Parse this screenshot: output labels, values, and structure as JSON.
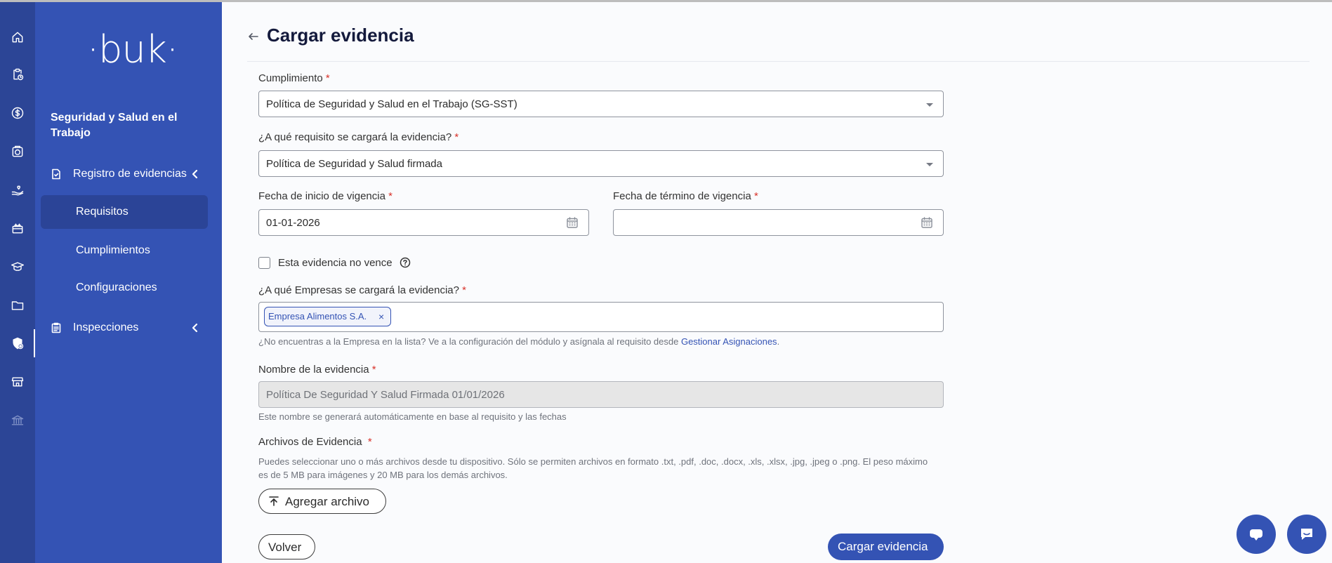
{
  "sidebar": {
    "logo": "·buk·",
    "module_title": "Seguridad y Salud en el Trabajo",
    "nav": {
      "registro": "Registro de evidencias",
      "requisitos": "Requisitos",
      "cumplimientos": "Cumplimientos",
      "configuraciones": "Configuraciones",
      "inspecciones": "Inspecciones"
    }
  },
  "rail_icons": [
    "home-icon",
    "clipboard-clock-icon",
    "dollar-circle-icon",
    "camera-icon",
    "hand-heart-icon",
    "gift-icon",
    "graduation-cap-icon",
    "folder-icon",
    "shield-gear-icon",
    "store-icon",
    "bank-icon"
  ],
  "page": {
    "title": "Cargar evidencia"
  },
  "form": {
    "required_mark": "*",
    "cumplimiento": {
      "label": "Cumplimiento",
      "value": "Política de Seguridad y Salud en el Trabajo (SG-SST)"
    },
    "requisito": {
      "label": "¿A qué requisito se cargará la evidencia?",
      "value": "Política de Seguridad y Salud firmada"
    },
    "fecha_inicio": {
      "label": "Fecha de inicio de vigencia",
      "value": "01-01-2026"
    },
    "fecha_termino": {
      "label": "Fecha de término de vigencia",
      "value": ""
    },
    "no_vence": {
      "label": "Esta evidencia no vence",
      "checked": false
    },
    "empresas": {
      "label": "¿A qué Empresas se cargará la evidencia?",
      "chips": [
        "Empresa Alimentos S.A."
      ],
      "chip_remove": "×",
      "hint": "¿No encuentras a la Empresa en la lista? Ve a la configuración del módulo y asígnala al requisito desde ",
      "hint_link": "Gestionar Asignaciones",
      "hint_end": "."
    },
    "nombre": {
      "label": "Nombre de la evidencia",
      "value": "Política De Seguridad Y Salud Firmada 01/01/2026",
      "hint": "Este nombre se generará automáticamente en base al requisito y las fechas"
    },
    "archivos": {
      "label": "Archivos de Evidencia",
      "description": "Puedes seleccionar uno o más archivos desde tu dispositivo. Sólo se permiten archivos en formato .txt, .pdf, .doc, .docx, .xls, .xlsx, .jpg, .jpeg o .png. El peso máximo es de 5 MB para imágenes y 20 MB para los demás archivos.",
      "add_button": "Agregar archivo"
    }
  },
  "actions": {
    "back": "Volver",
    "submit": "Cargar evidencia"
  },
  "colors": {
    "brand": "#3453b4",
    "rail": "#2c4596",
    "required": "#d8332b"
  }
}
